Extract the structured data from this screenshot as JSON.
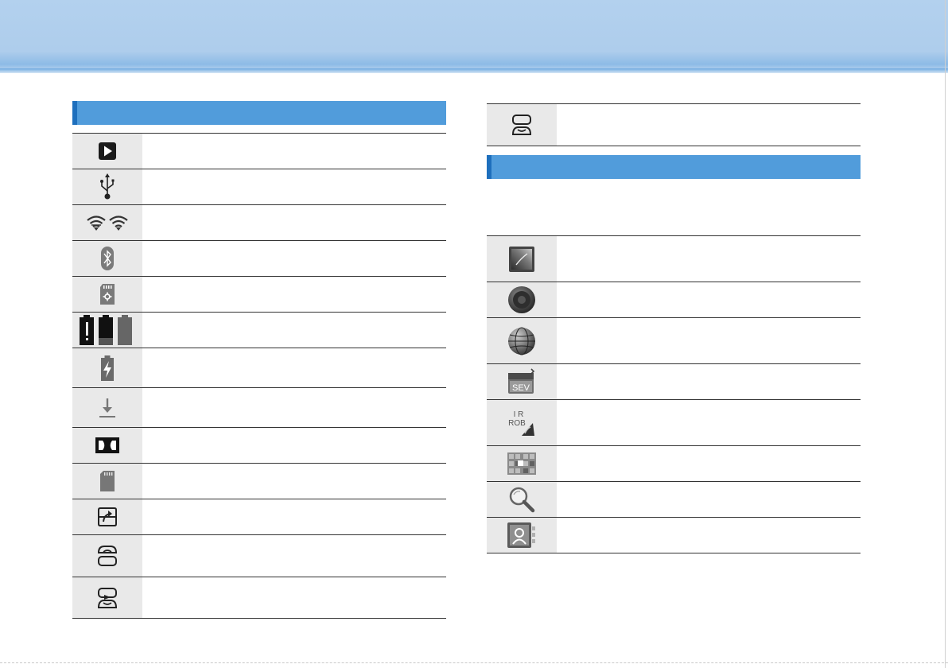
{
  "left_table": {
    "rows": [
      {
        "icon": "play-store-icon"
      },
      {
        "icon": "usb-icon"
      },
      {
        "icon": "wifi-hotspot-icon"
      },
      {
        "icon": "bluetooth-icon"
      },
      {
        "icon": "sd-card-setup-icon"
      },
      {
        "icon": "battery-status-icon"
      },
      {
        "icon": "battery-charging-icon"
      },
      {
        "icon": "download-icon"
      },
      {
        "icon": "dolby-icon"
      },
      {
        "icon": "sd-card-icon"
      },
      {
        "icon": "screen-mirror-icon"
      },
      {
        "icon": "dual-screen-icon"
      },
      {
        "icon": "screen-play-icon"
      }
    ]
  },
  "right_top_table": {
    "rows": [
      {
        "icon": "screen-link-icon"
      }
    ]
  },
  "right_apps_table": {
    "rows": [
      {
        "icon": "gallery-app-icon"
      },
      {
        "icon": "music-app-icon"
      },
      {
        "icon": "browser-app-icon"
      },
      {
        "icon": "sev-app-icon",
        "label": "SEV"
      },
      {
        "icon": "ir-remote-app-icon",
        "label_top": "I R",
        "label_bottom": "ROB"
      },
      {
        "icon": "apps-grid-icon"
      },
      {
        "icon": "search-app-icon"
      },
      {
        "icon": "contacts-app-icon"
      }
    ]
  }
}
